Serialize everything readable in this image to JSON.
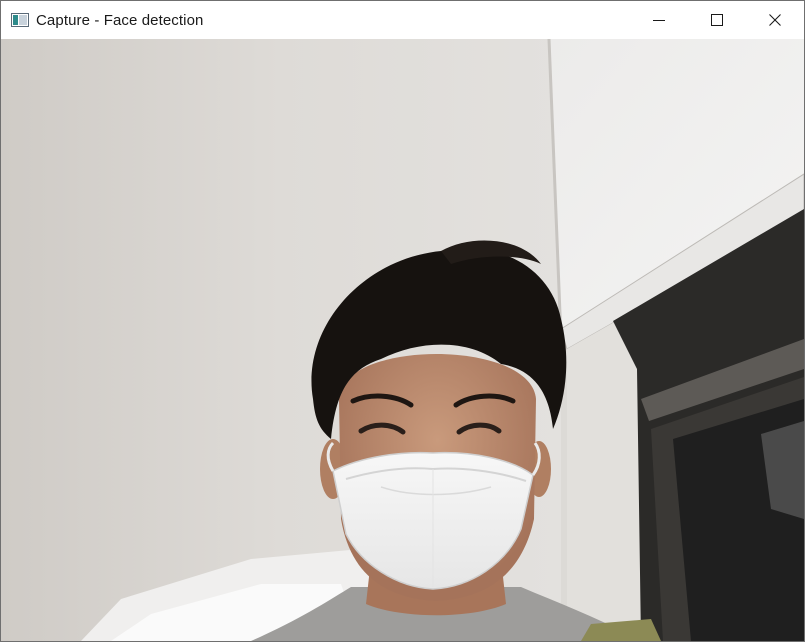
{
  "window": {
    "title": "Capture - Face detection",
    "icon": "app-window-icon",
    "controls": {
      "minimize": "minimize-icon",
      "maximize": "maximize-icon",
      "close": "close-icon"
    }
  },
  "camera_feed": {
    "content": "webcam-frame"
  }
}
